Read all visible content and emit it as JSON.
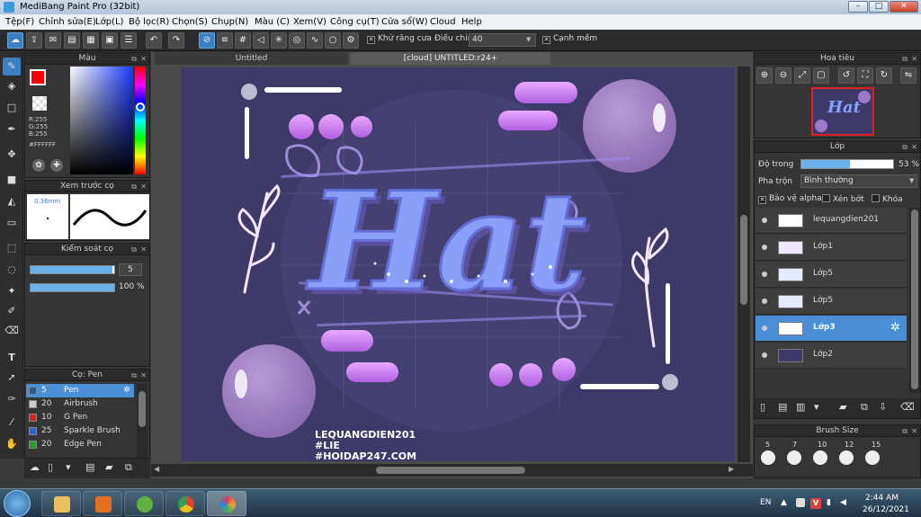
{
  "app": {
    "title": "MediBang Paint Pro (32bit)"
  },
  "window_buttons": {
    "minimize": "–",
    "maximize": "□",
    "close": "✕"
  },
  "menu": [
    "Tệp(F)",
    "Chỉnh sửa(E)",
    "Lớp(L)",
    "Bộ lọc(R)",
    "Chọn(S)",
    "Chụp(N)",
    "Màu (C)",
    "Xem(V)",
    "Công cụ(T)",
    "Cửa sổ(W)",
    "Cloud",
    "Help"
  ],
  "toolbar": {
    "antialias_label": "Khử răng cưa",
    "adjust_label": "Điều chỉnh",
    "adjust_value": "40",
    "sharp_edge_label": "Cạnh mềm"
  },
  "color_panel": {
    "title": "Màu",
    "r": "R:255",
    "g": "G:255",
    "b": "B:255",
    "hex": "#FFFFFF",
    "foreground": "#ff0000",
    "background": "#ffffff"
  },
  "brush_preview": {
    "title": "Xem trước cọ",
    "size": "0.36mm"
  },
  "brush_control": {
    "title": "Kiểm soát cọ",
    "size_value": "5",
    "opacity_value": "100 %",
    "opacity": 1.0,
    "size_fraction": 0.98
  },
  "brush_list": {
    "title": "Cọ: Pen",
    "items": [
      {
        "size": "5",
        "name": "Pen",
        "color": "#1e5fa8",
        "active": true
      },
      {
        "size": "20",
        "name": "Airbrush",
        "color": "#cccccc",
        "active": false
      },
      {
        "size": "10",
        "name": "G Pen",
        "color": "#e02020",
        "active": false
      },
      {
        "size": "25",
        "name": "Sparkle Brush",
        "color": "#3060e0",
        "active": false
      },
      {
        "size": "20",
        "name": "Edge Pen",
        "color": "#20a020",
        "active": false
      }
    ]
  },
  "tabs": [
    {
      "label": "Untitled",
      "active": false
    },
    {
      "label": "[cloud] UNTITLED:r24+",
      "active": true
    }
  ],
  "artwork": {
    "main_text": "Hat",
    "signature": [
      "LEQUANGDIEN201",
      "#LIE",
      "#HOIDAP247.COM"
    ],
    "bg_color": "#3d3a6a"
  },
  "navigator": {
    "title": "Hoa tiêu"
  },
  "layer_panel": {
    "title": "Lớp",
    "opacity_label": "Độ trong",
    "opacity_value": "53 %",
    "opacity": 0.53,
    "blend_label": "Pha trộn",
    "blend_value": "Bình thường",
    "protect_alpha": "Bảo vệ alpha",
    "clipping": "Xén bớt",
    "lock": "Khóa",
    "layers": [
      {
        "name": "lequangdien201",
        "active": false,
        "thumb": "#ffffff"
      },
      {
        "name": "Lớp1",
        "active": false,
        "thumb": "#f0e6ff"
      },
      {
        "name": "Lớp5",
        "active": false,
        "thumb": "#e6ecff"
      },
      {
        "name": "Lớp5",
        "active": false,
        "thumb": "#e6ecff"
      },
      {
        "name": "Lớp3",
        "active": true,
        "thumb": "#ffffff"
      },
      {
        "name": "Lớp2",
        "active": false,
        "thumb": "#3d3a6a"
      }
    ]
  },
  "brush_size": {
    "title": "Brush Size",
    "sizes": [
      "5",
      "7",
      "10",
      "12",
      "15"
    ]
  },
  "taskbar": {
    "lang": "EN",
    "time": "2:44 AM",
    "date": "26/12/2021"
  },
  "icons": {
    "toolbar": [
      "cloud-icon",
      "export-icon",
      "chat-icon",
      "note-icon",
      "book-icon",
      "grid-icon",
      "list-icon",
      "undo-icon",
      "redo-icon",
      "no-snap-icon",
      "parallel-snap-icon",
      "grid-snap-icon",
      "vanish-icon",
      "radial-icon",
      "circle-icon",
      "curve-icon",
      "ellipse-icon",
      "gear-icon"
    ],
    "tools": [
      "brush-icon",
      "eraser-icon",
      "rect-icon",
      "pen-icon",
      "move-icon",
      "fill-rect-icon",
      "bucket-icon",
      "gradient-icon",
      "select-icon",
      "lasso-icon",
      "magic-wand-icon",
      "select-pen-icon",
      "select-eraser-icon",
      "text-icon",
      "operation-icon",
      "eyedropper-icon",
      "divide-icon",
      "hand-icon"
    ]
  }
}
